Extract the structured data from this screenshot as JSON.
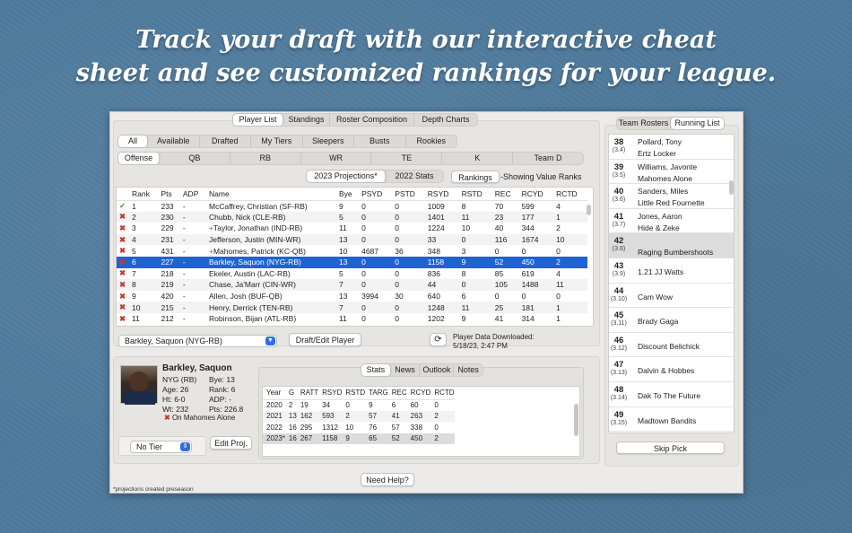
{
  "headline": {
    "line1": "Track your draft with our interactive cheat",
    "line2": "sheet and see customized rankings for your league."
  },
  "top_tabs": [
    "Player List",
    "Standings",
    "Roster Composition",
    "Depth Charts"
  ],
  "filter_tabs": [
    "All",
    "Available",
    "Drafted",
    "My Tiers",
    "Sleepers",
    "Busts",
    "Rookies"
  ],
  "position_tabs": [
    "Offense",
    "QB",
    "RB",
    "WR",
    "TE",
    "K",
    "Team D"
  ],
  "projection_tabs": [
    "2023 Projections*",
    "2022 Stats"
  ],
  "rankings_button": "Rankings",
  "showing_text": "-Showing Value Ranks",
  "table": {
    "headers": [
      "",
      "Rank",
      "Pts",
      "ADP",
      "Name",
      "Bye",
      "PSYD",
      "PSTD",
      "RSYD",
      "RSTD",
      "REC",
      "RCYD",
      "RCTD"
    ],
    "rows": [
      {
        "status": "✓",
        "rank": "1",
        "pts": "233",
        "adp": "-",
        "name": "McCaffrey, Christian (SF-RB)",
        "plus": "",
        "bye": "9",
        "psyd": "0",
        "pstd": "0",
        "rsyd": "1009",
        "rstd": "8",
        "rec": "70",
        "rcyd": "599",
        "rctd": "4"
      },
      {
        "status": "✖",
        "rank": "2",
        "pts": "230",
        "adp": "-",
        "name": "Chubb, Nick (CLE-RB)",
        "plus": "",
        "bye": "5",
        "psyd": "0",
        "pstd": "0",
        "rsyd": "1401",
        "rstd": "11",
        "rec": "23",
        "rcyd": "177",
        "rctd": "1"
      },
      {
        "status": "✖",
        "rank": "3",
        "pts": "229",
        "adp": "-",
        "name": "Taylor, Jonathan (IND-RB)",
        "plus": "+",
        "bye": "11",
        "psyd": "0",
        "pstd": "0",
        "rsyd": "1224",
        "rstd": "10",
        "rec": "40",
        "rcyd": "344",
        "rctd": "2"
      },
      {
        "status": "✖",
        "rank": "4",
        "pts": "231",
        "adp": "-",
        "name": "Jefferson, Justin (MIN-WR)",
        "plus": "",
        "bye": "13",
        "psyd": "0",
        "pstd": "0",
        "rsyd": "33",
        "rstd": "0",
        "rec": "116",
        "rcyd": "1674",
        "rctd": "10"
      },
      {
        "status": "✖",
        "rank": "5",
        "pts": "431",
        "adp": "-",
        "name": "Mahomes, Patrick (KC-QB)",
        "plus": "+",
        "bye": "10",
        "psyd": "4687",
        "pstd": "36",
        "rsyd": "348",
        "rstd": "3",
        "rec": "0",
        "rcyd": "0",
        "rctd": "0"
      },
      {
        "status": "✖",
        "rank": "6",
        "pts": "227",
        "adp": "-",
        "name": "Barkley, Saquon (NYG-RB)",
        "plus": "",
        "bye": "13",
        "psyd": "0",
        "pstd": "0",
        "rsyd": "1158",
        "rstd": "9",
        "rec": "52",
        "rcyd": "450",
        "rctd": "2",
        "selected": true
      },
      {
        "status": "✖",
        "rank": "7",
        "pts": "218",
        "adp": "-",
        "name": "Ekeler, Austin (LAC-RB)",
        "plus": "",
        "bye": "5",
        "psyd": "0",
        "pstd": "0",
        "rsyd": "836",
        "rstd": "8",
        "rec": "85",
        "rcyd": "619",
        "rctd": "4"
      },
      {
        "status": "✖",
        "rank": "8",
        "pts": "219",
        "adp": "-",
        "name": "Chase, Ja'Marr (CIN-WR)",
        "plus": "",
        "bye": "7",
        "psyd": "0",
        "pstd": "0",
        "rsyd": "44",
        "rstd": "0",
        "rec": "105",
        "rcyd": "1488",
        "rctd": "11"
      },
      {
        "status": "✖",
        "rank": "9",
        "pts": "420",
        "adp": "-",
        "name": "Allen, Josh (BUF-QB)",
        "plus": "",
        "bye": "13",
        "psyd": "3994",
        "pstd": "30",
        "rsyd": "640",
        "rstd": "6",
        "rec": "0",
        "rcyd": "0",
        "rctd": "0"
      },
      {
        "status": "✖",
        "rank": "10",
        "pts": "215",
        "adp": "-",
        "name": "Henry, Derrick (TEN-RB)",
        "plus": "",
        "bye": "7",
        "psyd": "0",
        "pstd": "0",
        "rsyd": "1248",
        "rstd": "11",
        "rec": "25",
        "rcyd": "181",
        "rctd": "1"
      },
      {
        "status": "✖",
        "rank": "11",
        "pts": "212",
        "adp": "-",
        "name": "Robinson, Bijan (ATL-RB)",
        "plus": "",
        "bye": "11",
        "psyd": "0",
        "pstd": "0",
        "rsyd": "1202",
        "rstd": "9",
        "rec": "41",
        "rcyd": "314",
        "rctd": "1"
      }
    ]
  },
  "player_select": "Barkley, Saquon (NYG-RB)",
  "draft_edit_button": "Draft/Edit Player",
  "data_downloaded": {
    "label": "Player Data Downloaded:",
    "date": "5/18/23, 2:47 PM"
  },
  "player": {
    "name": "Barkley, Saquon",
    "team_pos": "NYG (RB)",
    "bye": "Bye: 13",
    "age": "Age: 26",
    "rank": "Rank: 6",
    "ht": "Ht: 6-0",
    "adp": "ADP: -",
    "wt": "Wt: 232",
    "pts": "Pts: 226.8",
    "on_team": "On Mahomes Alone"
  },
  "tier_select": "No Tier",
  "edit_proj_button": "Edit Proj.",
  "detail_tabs": [
    "Stats",
    "News",
    "Outlook",
    "Notes"
  ],
  "stats": {
    "headers": [
      "Year",
      "G",
      "RATT",
      "RSYD",
      "RSTD",
      "TARG",
      "REC",
      "RCYD",
      "RCTD"
    ],
    "rows": [
      [
        "2020",
        "2",
        "19",
        "34",
        "0",
        "9",
        "6",
        "60",
        "0"
      ],
      [
        "2021",
        "13",
        "162",
        "593",
        "2",
        "57",
        "41",
        "263",
        "2"
      ],
      [
        "2022",
        "16",
        "295",
        "1312",
        "10",
        "76",
        "57",
        "338",
        "0"
      ],
      [
        "2023*",
        "16",
        "267",
        "1158",
        "9",
        "65",
        "52",
        "450",
        "2"
      ]
    ]
  },
  "help_button": "Need Help?",
  "footnote": "*projections created preseason",
  "right_tabs": [
    "Team Rosters",
    "Running List"
  ],
  "running_list": [
    {
      "num": "38",
      "sub": "(3.4)",
      "l1": "Pollard, Tony",
      "l2": "Ertz Locker"
    },
    {
      "num": "39",
      "sub": "(3.5)",
      "l1": "Williams, Javonte",
      "l2": "Mahomes Alone"
    },
    {
      "num": "40",
      "sub": "(3.6)",
      "l1": "Sanders, Miles",
      "l2": "Little Red Fournette"
    },
    {
      "num": "41",
      "sub": "(3.7)",
      "l1": "Jones, Aaron",
      "l2": "Hide & Zeke"
    },
    {
      "num": "42",
      "sub": "(3.8)",
      "l1": "",
      "l2": "Raging Bumbershoots",
      "selected": true
    },
    {
      "num": "43",
      "sub": "(3.9)",
      "l1": "",
      "l2": "1.21 JJ Watts"
    },
    {
      "num": "44",
      "sub": "(3.10)",
      "l1": "",
      "l2": "Cam Wow"
    },
    {
      "num": "45",
      "sub": "(3.11)",
      "l1": "",
      "l2": "Brady Gaga"
    },
    {
      "num": "46",
      "sub": "(3.12)",
      "l1": "",
      "l2": "Discount Belichick"
    },
    {
      "num": "47",
      "sub": "(3.13)",
      "l1": "",
      "l2": "Dalvin & Hobbes"
    },
    {
      "num": "48",
      "sub": "(3.14)",
      "l1": "",
      "l2": "Dak To The Future"
    },
    {
      "num": "49",
      "sub": "(3.15)",
      "l1": "",
      "l2": "Madtown Bandits"
    }
  ],
  "skip_pick_button": "Skip Pick",
  "colors": {
    "selection": "#1f63d3",
    "drafted_x": "#c23b2e",
    "check": "#2a8f2a",
    "background": "#4f7a9c"
  }
}
